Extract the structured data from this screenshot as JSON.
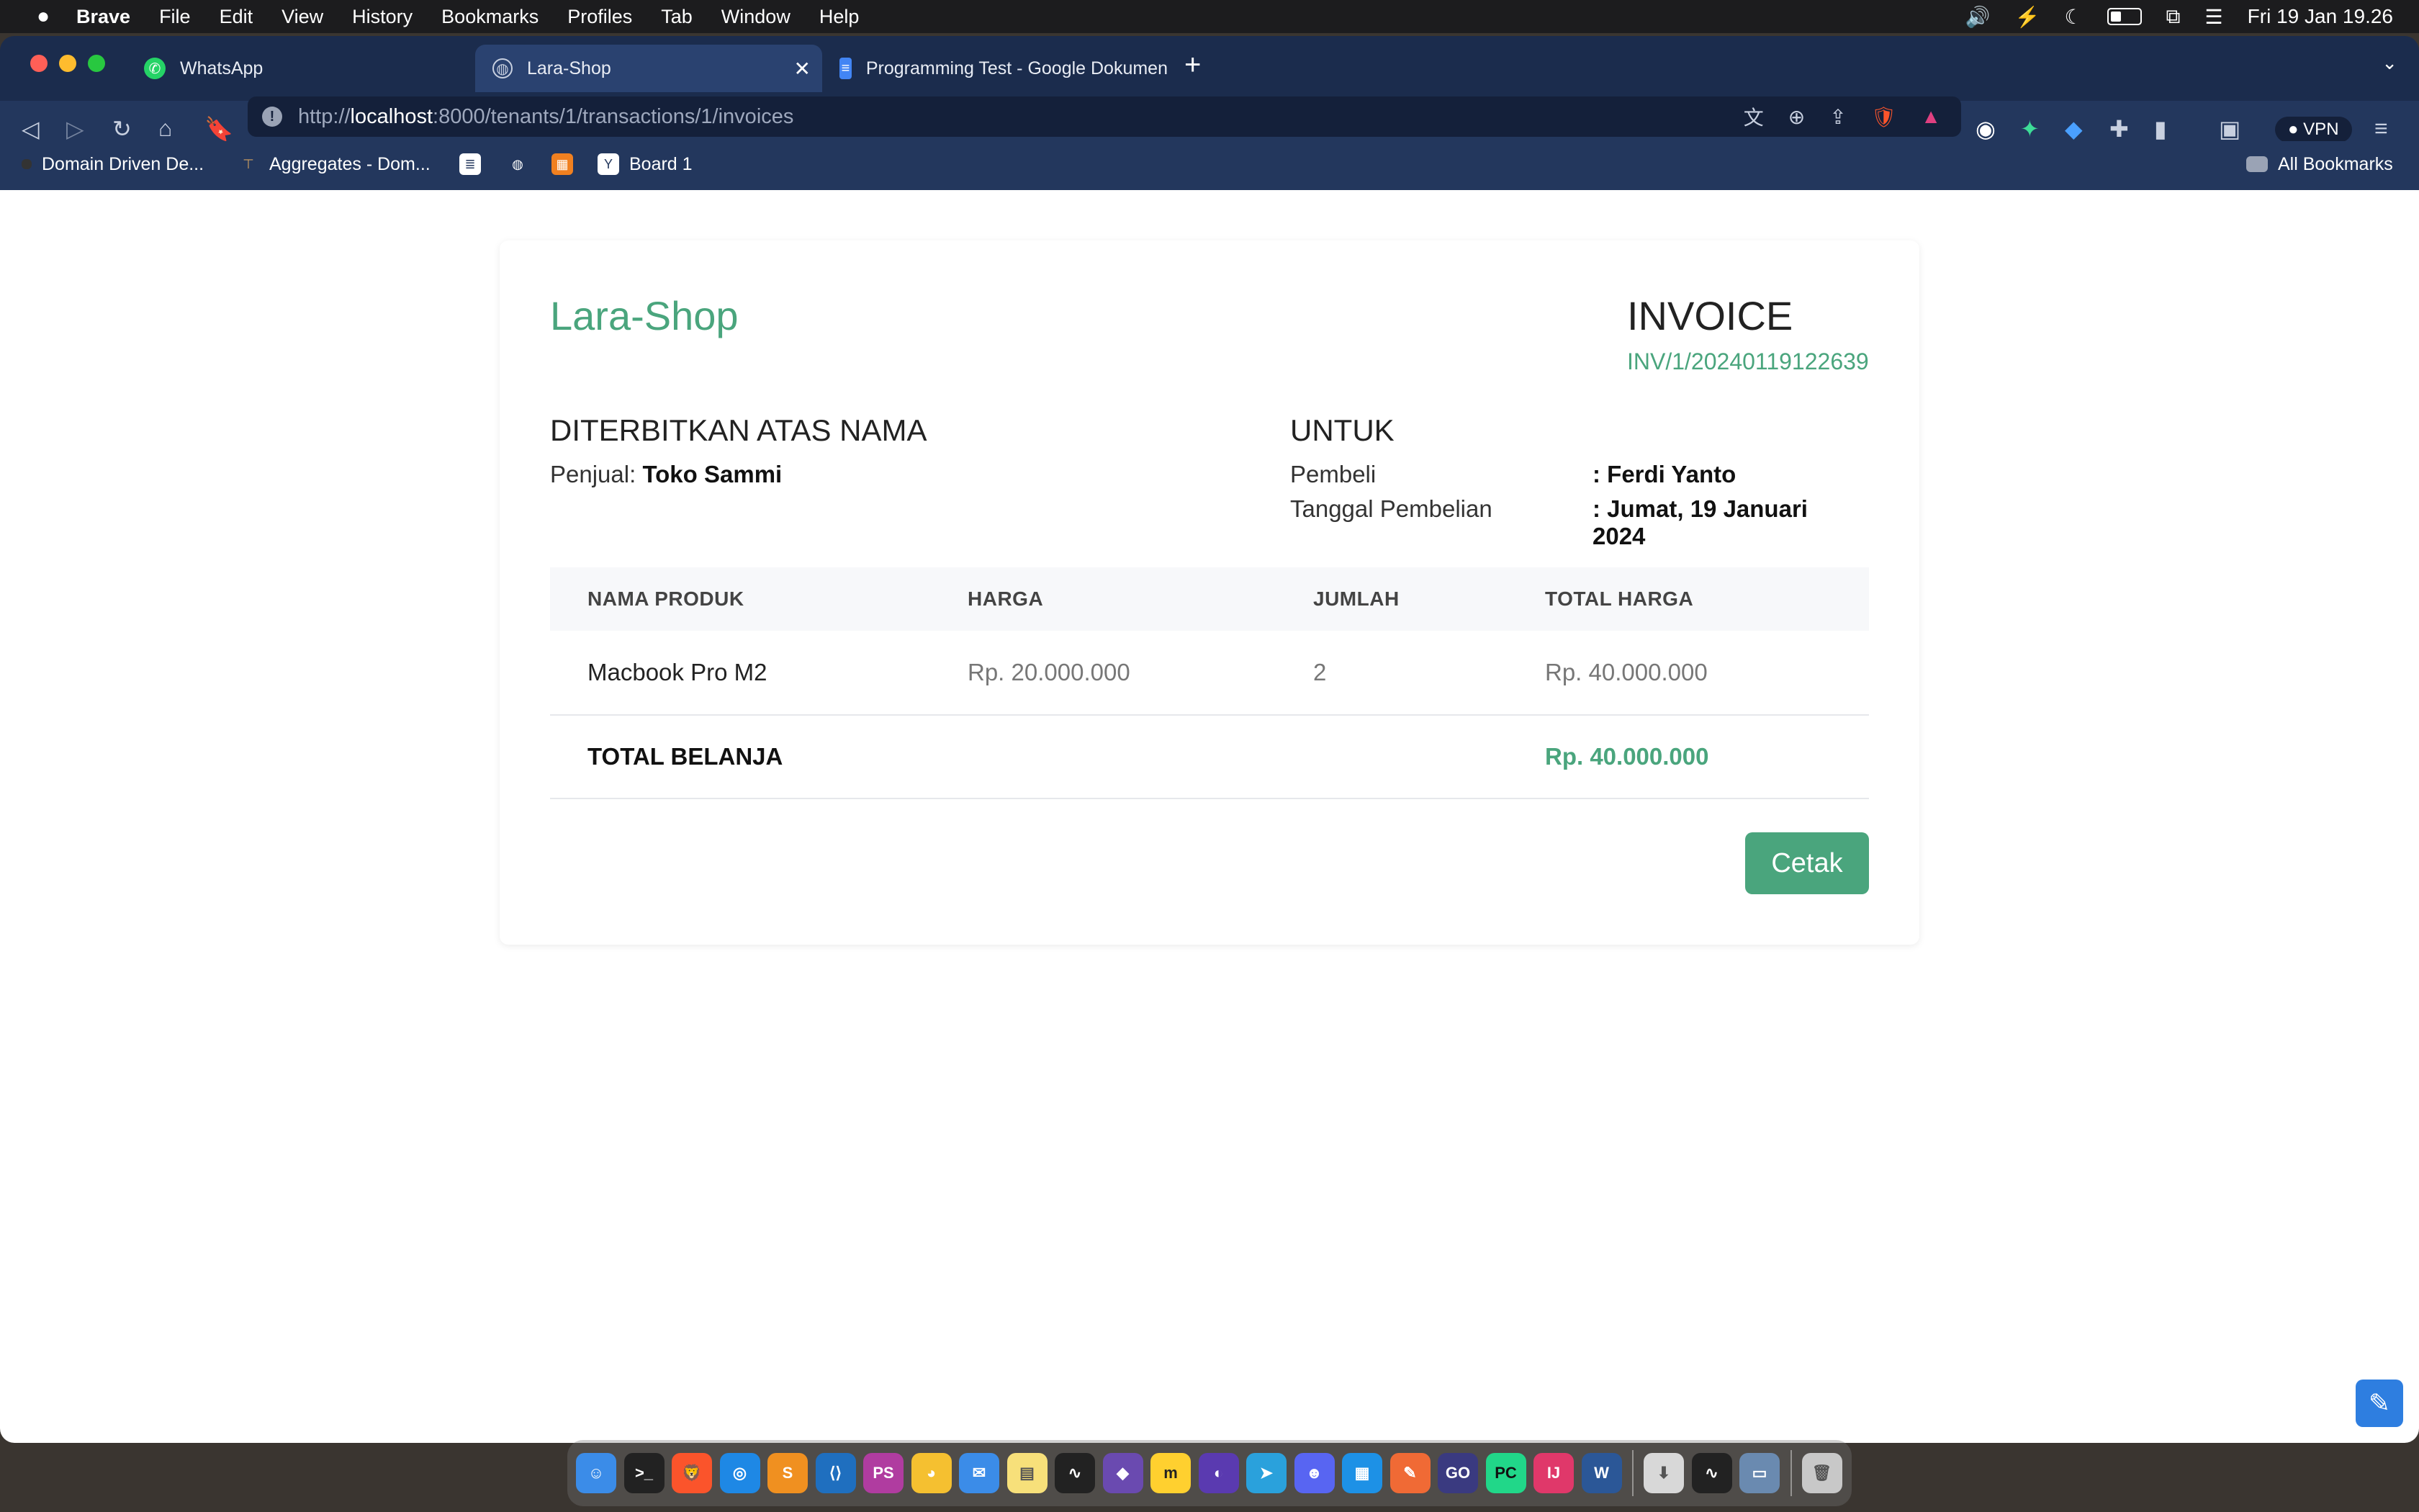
{
  "menubar": {
    "app_name": "Brave",
    "items": [
      "File",
      "Edit",
      "View",
      "History",
      "Bookmarks",
      "Profiles",
      "Tab",
      "Window",
      "Help"
    ],
    "datetime": "Fri 19 Jan  19.26"
  },
  "tabs": [
    {
      "label": "WhatsApp",
      "icon": "whatsapp-icon"
    },
    {
      "label": "Lara-Shop",
      "icon": "globe-icon",
      "active": true
    },
    {
      "label": "Programming Test - Google Dokumen",
      "icon": "google-docs-icon"
    }
  ],
  "address_bar": {
    "scheme": "http://",
    "host": "localhost",
    "path": ":8000/tenants/1/transactions/1/invoices"
  },
  "toolbar": {
    "vpn_label": "VPN"
  },
  "bookmarks": {
    "items": [
      {
        "label": "Domain Driven De..."
      },
      {
        "label": "Aggregates - Dom..."
      },
      {
        "label": "Board 1"
      }
    ],
    "all_label": "All Bookmarks"
  },
  "invoice": {
    "brand": "Lara-Shop",
    "title": "INVOICE",
    "number": "INV/1/20240119122639",
    "issuer_heading": "DITERBITKAN ATAS NAMA",
    "seller_label": "Penjual:",
    "seller_name": "Toko Sammi",
    "recipient_heading": "UNTUK",
    "buyer_label": "Pembeli",
    "buyer_value": ": Ferdi Yanto",
    "date_label": "Tanggal Pembelian",
    "date_value": ": Jumat, 19 Januari 2024",
    "columns": [
      "NAMA PRODUK",
      "HARGA",
      "JUMLAH",
      "TOTAL HARGA"
    ],
    "rows": [
      {
        "product": "Macbook Pro M2",
        "price": "Rp. 20.000.000",
        "qty": "2",
        "total": "Rp. 40.000.000"
      }
    ],
    "grand_total_label": "TOTAL BELANJA",
    "grand_total_value": "Rp. 40.000.000",
    "print_button": "Cetak"
  },
  "colors": {
    "accent": "#4aa57d",
    "tabbar": "#1b2c4d",
    "toolbar": "#23375d"
  }
}
